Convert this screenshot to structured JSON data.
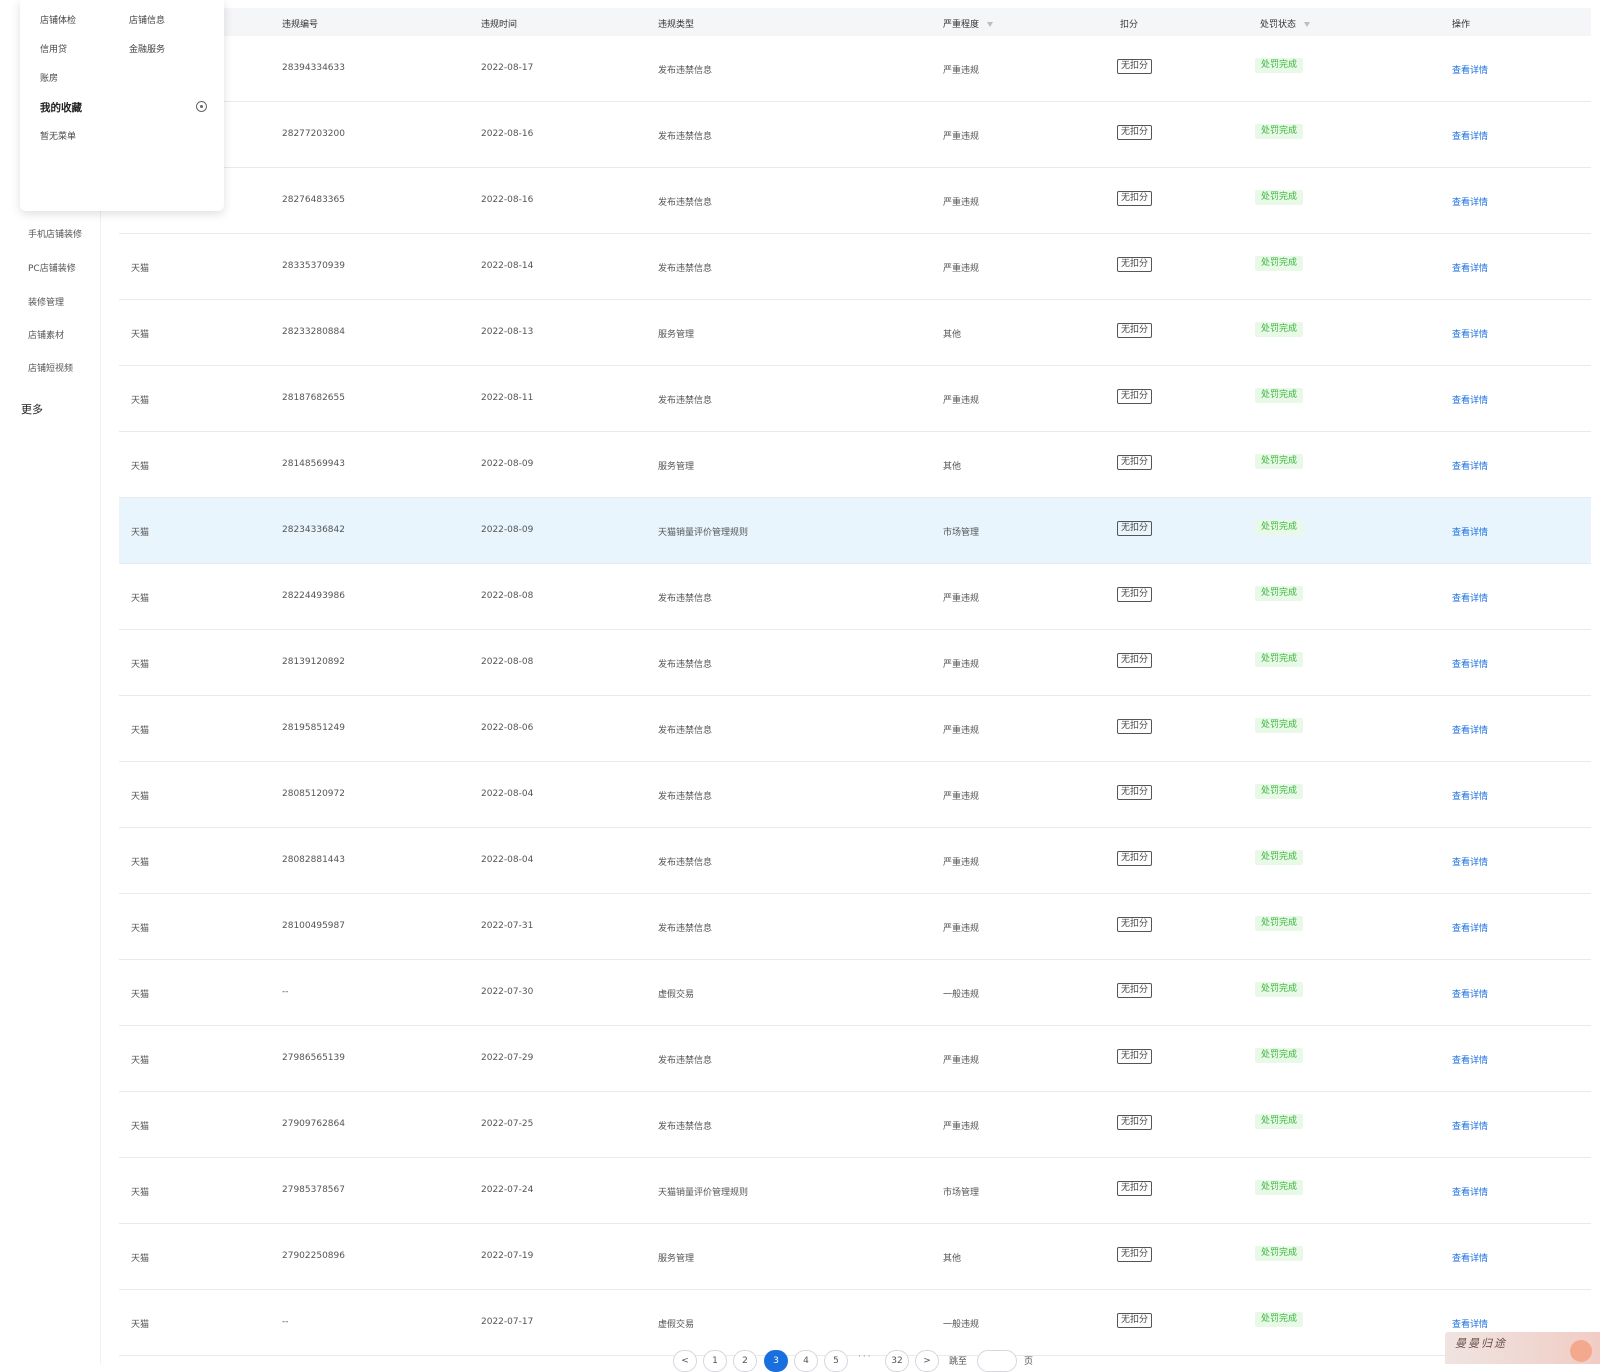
{
  "sidebar": {
    "items": [
      "手机店铺装修",
      "PC店铺装修",
      "装修管理",
      "店铺素材",
      "店铺短视频"
    ],
    "more": "更多"
  },
  "popup": {
    "links": [
      "店铺体检",
      "店铺信息",
      "信用贷",
      "金融服务",
      "账房"
    ],
    "favorites_title": "我的收藏",
    "favorites_empty": "暂无菜单"
  },
  "table": {
    "columns": [
      "违规编号",
      "违规时间",
      "违规类型",
      "严重程度",
      "扣分",
      "处罚状态",
      "操作"
    ],
    "rows": [
      {
        "platform": "",
        "id": "28394334633",
        "date": "2022-08-17",
        "type": "发布违禁信息",
        "severity": "严重违规",
        "points": "无扣分",
        "status": "处罚完成",
        "action": "查看详情"
      },
      {
        "platform": "",
        "id": "28277203200",
        "date": "2022-08-16",
        "type": "发布违禁信息",
        "severity": "严重违规",
        "points": "无扣分",
        "status": "处罚完成",
        "action": "查看详情"
      },
      {
        "platform": "",
        "id": "28276483365",
        "date": "2022-08-16",
        "type": "发布违禁信息",
        "severity": "严重违规",
        "points": "无扣分",
        "status": "处罚完成",
        "action": "查看详情"
      },
      {
        "platform": "天猫",
        "id": "28335370939",
        "date": "2022-08-14",
        "type": "发布违禁信息",
        "severity": "严重违规",
        "points": "无扣分",
        "status": "处罚完成",
        "action": "查看详情"
      },
      {
        "platform": "天猫",
        "id": "28233280884",
        "date": "2022-08-13",
        "type": "服务管理",
        "severity": "其他",
        "points": "无扣分",
        "status": "处罚完成",
        "action": "查看详情"
      },
      {
        "platform": "天猫",
        "id": "28187682655",
        "date": "2022-08-11",
        "type": "发布违禁信息",
        "severity": "严重违规",
        "points": "无扣分",
        "status": "处罚完成",
        "action": "查看详情"
      },
      {
        "platform": "天猫",
        "id": "28148569943",
        "date": "2022-08-09",
        "type": "服务管理",
        "severity": "其他",
        "points": "无扣分",
        "status": "处罚完成",
        "action": "查看详情"
      },
      {
        "platform": "天猫",
        "id": "28234336842",
        "date": "2022-08-09",
        "type": "天猫销量评价管理规则",
        "severity": "市场管理",
        "points": "无扣分",
        "status": "处罚完成",
        "action": "查看详情"
      },
      {
        "platform": "天猫",
        "id": "28224493986",
        "date": "2022-08-08",
        "type": "发布违禁信息",
        "severity": "严重违规",
        "points": "无扣分",
        "status": "处罚完成",
        "action": "查看详情"
      },
      {
        "platform": "天猫",
        "id": "28139120892",
        "date": "2022-08-08",
        "type": "发布违禁信息",
        "severity": "严重违规",
        "points": "无扣分",
        "status": "处罚完成",
        "action": "查看详情"
      },
      {
        "platform": "天猫",
        "id": "28195851249",
        "date": "2022-08-06",
        "type": "发布违禁信息",
        "severity": "严重违规",
        "points": "无扣分",
        "status": "处罚完成",
        "action": "查看详情"
      },
      {
        "platform": "天猫",
        "id": "28085120972",
        "date": "2022-08-04",
        "type": "发布违禁信息",
        "severity": "严重违规",
        "points": "无扣分",
        "status": "处罚完成",
        "action": "查看详情"
      },
      {
        "platform": "天猫",
        "id": "28082881443",
        "date": "2022-08-04",
        "type": "发布违禁信息",
        "severity": "严重违规",
        "points": "无扣分",
        "status": "处罚完成",
        "action": "查看详情"
      },
      {
        "platform": "天猫",
        "id": "28100495987",
        "date": "2022-07-31",
        "type": "发布违禁信息",
        "severity": "严重违规",
        "points": "无扣分",
        "status": "处罚完成",
        "action": "查看详情"
      },
      {
        "platform": "天猫",
        "id": "--",
        "date": "2022-07-30",
        "type": "虚假交易",
        "severity": "一般违规",
        "points": "无扣分",
        "status": "处罚完成",
        "action": "查看详情"
      },
      {
        "platform": "天猫",
        "id": "27986565139",
        "date": "2022-07-29",
        "type": "发布违禁信息",
        "severity": "严重违规",
        "points": "无扣分",
        "status": "处罚完成",
        "action": "查看详情"
      },
      {
        "platform": "天猫",
        "id": "27909762864",
        "date": "2022-07-25",
        "type": "发布违禁信息",
        "severity": "严重违规",
        "points": "无扣分",
        "status": "处罚完成",
        "action": "查看详情"
      },
      {
        "platform": "天猫",
        "id": "27985378567",
        "date": "2022-07-24",
        "type": "天猫销量评价管理规则",
        "severity": "市场管理",
        "points": "无扣分",
        "status": "处罚完成",
        "action": "查看详情"
      },
      {
        "platform": "天猫",
        "id": "27902250896",
        "date": "2022-07-19",
        "type": "服务管理",
        "severity": "其他",
        "points": "无扣分",
        "status": "处罚完成",
        "action": "查看详情"
      },
      {
        "platform": "天猫",
        "id": "--",
        "date": "2022-07-17",
        "type": "虚假交易",
        "severity": "一般违规",
        "points": "无扣分",
        "status": "处罚完成",
        "action": "查看详情"
      }
    ],
    "highlighted_row": 7
  },
  "pagination": {
    "prev": "<",
    "next": ">",
    "pages": [
      "1",
      "2",
      "3",
      "4",
      "5"
    ],
    "current": "3",
    "ellipsis": "···",
    "last": "32",
    "jump_label": "跳至",
    "page_unit": "页"
  },
  "watermark": {
    "text": "曼曼归途"
  },
  "colors": {
    "accent": "#1a6fe0",
    "status_text": "#3bb53b",
    "status_bg": "#e8f9e8",
    "highlight_row": "#e8f5fd"
  }
}
